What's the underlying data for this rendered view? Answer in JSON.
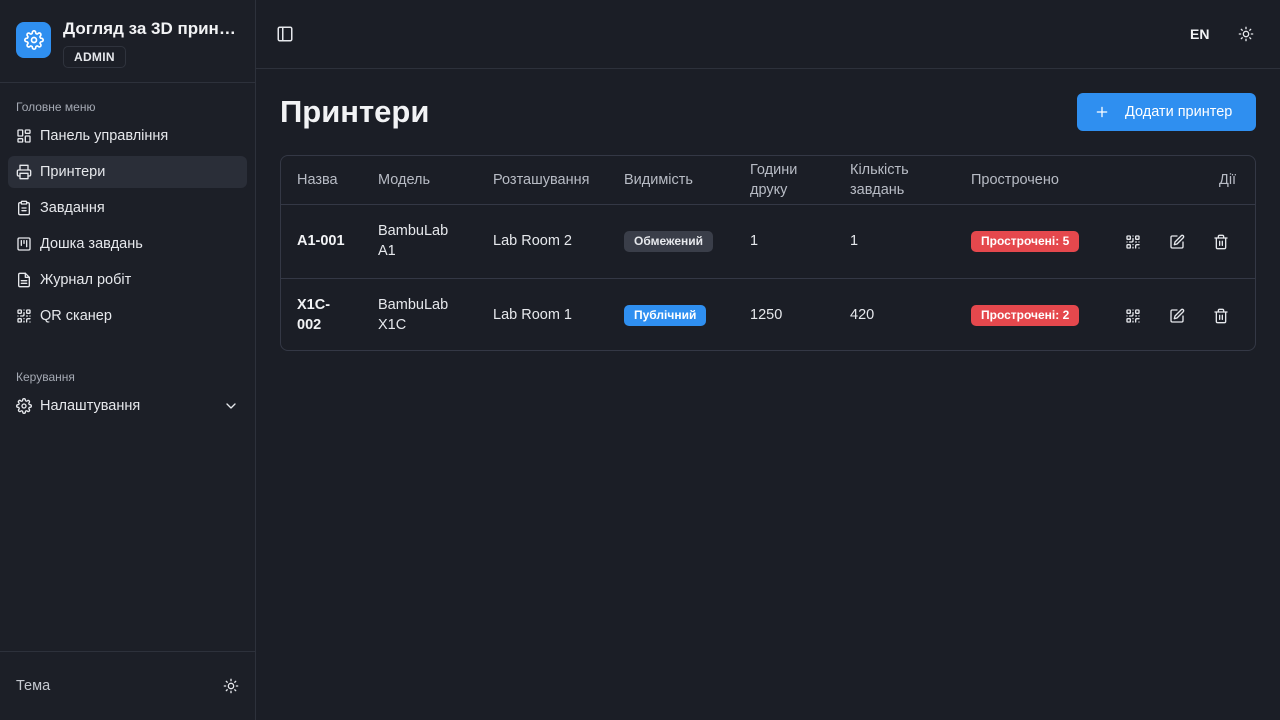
{
  "app": {
    "title": "Догляд за 3D принт…",
    "role": "ADMIN"
  },
  "sidebar": {
    "main_label": "Головне меню",
    "items": [
      {
        "label": "Панель управління",
        "icon": "dashboard-icon"
      },
      {
        "label": "Принтери",
        "icon": "printer-icon",
        "active": true
      },
      {
        "label": "Завдання",
        "icon": "clipboard-icon"
      },
      {
        "label": "Дошка завдань",
        "icon": "kanban-icon"
      },
      {
        "label": "Журнал робіт",
        "icon": "file-text-icon"
      },
      {
        "label": "QR сканер",
        "icon": "qr-code-icon"
      }
    ],
    "manage_label": "Керування",
    "settings_label": "Налаштування",
    "footer_theme_label": "Тема"
  },
  "topbar": {
    "lang": "EN"
  },
  "page": {
    "title": "Принтери",
    "add_button": "Додати принтер"
  },
  "table": {
    "headers": {
      "name": "Назва",
      "model": "Модель",
      "location": "Розташування",
      "visibility": "Видимість",
      "hours_line1": "Години",
      "hours_line2": "друку",
      "tasks_line1": "Кількість",
      "tasks_line2": "завдань",
      "overdue": "Прострочено",
      "actions": "Дії"
    },
    "rows": [
      {
        "name_line1": "A1-001",
        "name_line2": "",
        "model_line1": "BambuLab",
        "model_line2": "A1",
        "location": "Lab Room 2",
        "visibility": "Обмежений",
        "visibility_type": "restricted",
        "hours": "1",
        "tasks": "1",
        "overdue": "Прострочені: 5"
      },
      {
        "name_line1": "X1C-",
        "name_line2": "002",
        "model_line1": "BambuLab",
        "model_line2": "X1C",
        "location": "Lab Room 1",
        "visibility": "Публічний",
        "visibility_type": "public",
        "hours": "1250",
        "tasks": "420",
        "overdue": "Прострочені: 2"
      }
    ]
  },
  "colors": {
    "accent": "#2f8ff0",
    "danger": "#e5484d",
    "background": "#1b1e26"
  }
}
